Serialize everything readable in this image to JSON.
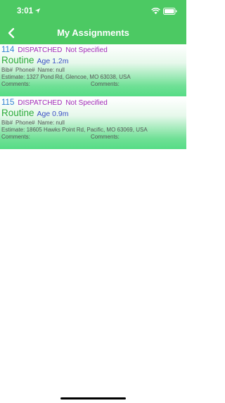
{
  "status_bar": {
    "time": "3:01"
  },
  "header": {
    "title": "My Assignments"
  },
  "assignments": [
    {
      "number": "114",
      "status": "DISPATCHED",
      "specified": "Not Specified",
      "priority": "Routine",
      "age": "Age 1.2m",
      "bib_label": "Bib#",
      "phone_label": "Phone#",
      "name": "Name: null",
      "estimate": "Estimate: 1327 Pond Rd, Glencoe, MO 63038, USA",
      "comments_label": "Comments:",
      "comments_label_2": "Comments:"
    },
    {
      "number": "115",
      "status": "DISPATCHED",
      "specified": "Not Specified",
      "priority": "Routine",
      "age": "Age 0.9m",
      "bib_label": "Bib#",
      "phone_label": "Phone#",
      "name": "Name: null",
      "estimate": "Estimate: 18605 Hawks Point Rd, Pacific, MO 63069, USA",
      "comments_label": "Comments:",
      "comments_label_2": "Comments:"
    }
  ],
  "colors": {
    "header": "#4cc963",
    "number": "#2e7fd1",
    "status": "#a32ab8",
    "priority": "#2bab3a",
    "age": "#3a4fc4"
  }
}
